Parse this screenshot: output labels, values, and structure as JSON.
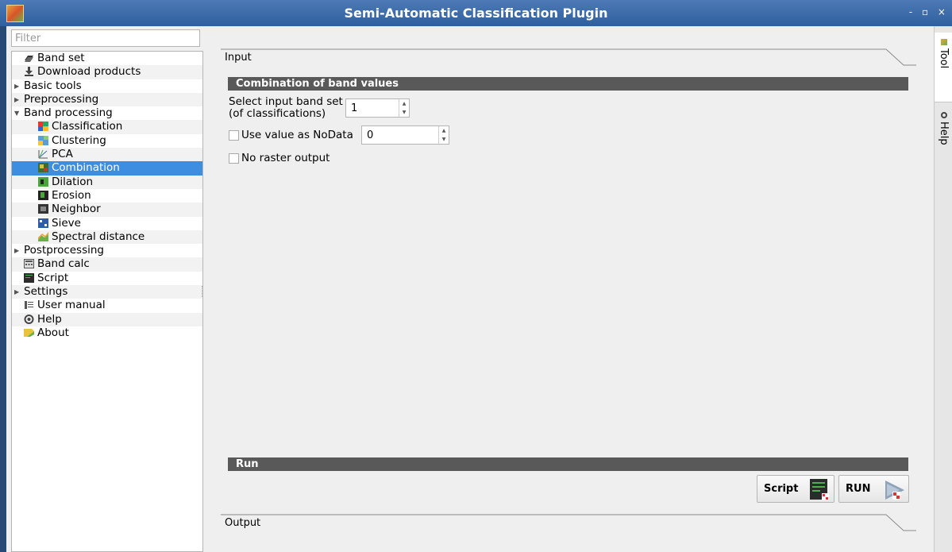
{
  "window": {
    "title": "Semi-Automatic Classification Plugin",
    "controls": "- ▫ ×"
  },
  "sidebar": {
    "filter_placeholder": "Filter",
    "items": [
      {
        "label": "Band set",
        "icon": "band-set-icon"
      },
      {
        "label": "Download products",
        "icon": "download-icon"
      },
      {
        "label": "Basic tools",
        "expander": "collapsed"
      },
      {
        "label": "Preprocessing",
        "expander": "collapsed"
      },
      {
        "label": "Band processing",
        "expander": "expanded"
      },
      {
        "label": "Classification",
        "icon": "classification-icon"
      },
      {
        "label": "Clustering",
        "icon": "clustering-icon"
      },
      {
        "label": "PCA",
        "icon": "pca-icon"
      },
      {
        "label": "Combination",
        "icon": "combination-icon",
        "selected": true
      },
      {
        "label": "Dilation",
        "icon": "dilation-icon"
      },
      {
        "label": "Erosion",
        "icon": "erosion-icon"
      },
      {
        "label": "Neighbor",
        "icon": "neighbor-icon"
      },
      {
        "label": "Sieve",
        "icon": "sieve-icon"
      },
      {
        "label": "Spectral distance",
        "icon": "spectral-distance-icon"
      },
      {
        "label": "Postprocessing",
        "expander": "collapsed"
      },
      {
        "label": "Band calc",
        "icon": "band-calc-icon"
      },
      {
        "label": "Script",
        "icon": "script-icon"
      },
      {
        "label": "Settings",
        "expander": "collapsed"
      },
      {
        "label": "User manual",
        "icon": "user-manual-icon"
      },
      {
        "label": "Help",
        "icon": "help-icon"
      },
      {
        "label": "About",
        "icon": "about-icon"
      }
    ]
  },
  "main": {
    "input_label": "Input",
    "combination_header": "Combination of band values",
    "band_set_label_line1": "Select input band set",
    "band_set_label_line2": "(of classifications)",
    "band_set_value": "1",
    "nodata_label": "Use value as NoData",
    "nodata_value": "0",
    "nodata_checked": false,
    "no_raster_label": "No raster output",
    "no_raster_checked": false,
    "run_header": "Run",
    "script_button": "Script",
    "run_button": "RUN",
    "output_label": "Output"
  },
  "right_tabs": {
    "tool": "Tool",
    "help": "Help"
  },
  "colors": {
    "selection": "#3d8ee0",
    "header_bar": "#595959",
    "title_bar": "#3a679f"
  }
}
